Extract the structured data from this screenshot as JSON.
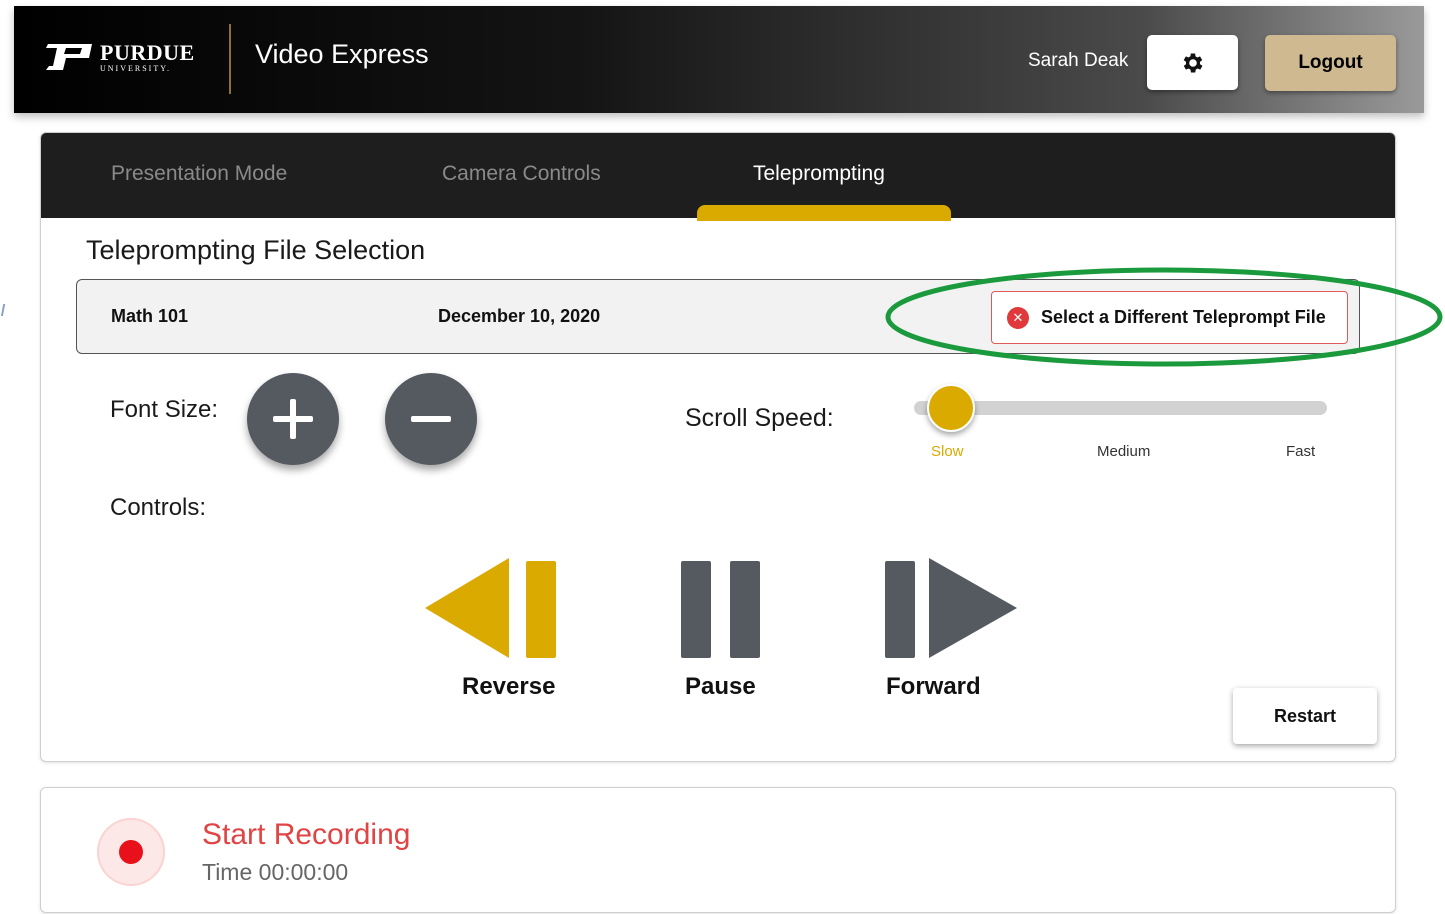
{
  "header": {
    "logo_word": "PURDUE",
    "logo_sub": "UNIVERSITY.",
    "app_title": "Video Express",
    "user_name": "Sarah Deak",
    "logout_label": "Logout"
  },
  "tabs": [
    {
      "label": "Presentation Mode",
      "active": false
    },
    {
      "label": "Camera Controls",
      "active": false
    },
    {
      "label": "Teleprompting",
      "active": true
    }
  ],
  "teleprompt": {
    "section_title": "Teleprompting File Selection",
    "file": {
      "name": "Math 101",
      "date": "December 10, 2020",
      "select_label": "Select a Different Teleprompt File"
    },
    "font_size_label": "Font Size:",
    "scroll_speed": {
      "label": "Scroll Speed:",
      "options": [
        "Slow",
        "Medium",
        "Fast"
      ],
      "selected": "Slow"
    },
    "controls_label": "Controls:",
    "controls": {
      "reverse": "Reverse",
      "pause": "Pause",
      "forward": "Forward"
    },
    "restart_label": "Restart"
  },
  "recording": {
    "title": "Start Recording",
    "time": "Time 00:00:00"
  },
  "colors": {
    "gold": "#daaa00",
    "old_gold": "#cfb991",
    "dark": "#1e1e1e",
    "button_gray": "#555960",
    "record_red": "#e8101a",
    "annotation_green": "#1a9a3c"
  }
}
